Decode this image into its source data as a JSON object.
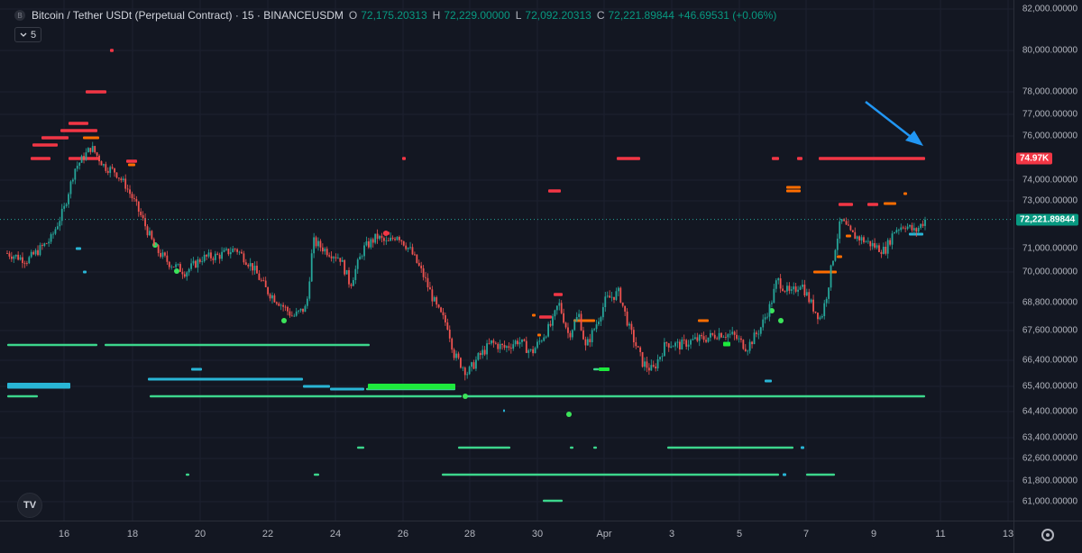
{
  "header": {
    "symbol_icon": "B",
    "title": "Bitcoin / Tether USDt (Perpetual Contract) · 15 · BINANCEUSDM",
    "open_label": "O",
    "open": "72,175.20313",
    "high_label": "H",
    "high": "72,229.00000",
    "low_label": "L",
    "low": "72,092.20313",
    "close_label": "C",
    "close": "72,221.89844",
    "change": "+46.69531 (+0.06%)",
    "indicator_toggle_icon": "chevron-down-icon",
    "indicator_count": "5"
  },
  "price_axis": {
    "labels": [
      "82,000.00000",
      "80,000.00000",
      "78,000.00000",
      "77,000.00000",
      "76,000.00000",
      "74,000.00000",
      "73,000.00000",
      "71,000.00000",
      "70,000.00000",
      "68,800.00000",
      "67,600.00000",
      "66,400.00000",
      "65,400.00000",
      "64,400.00000",
      "63,400.00000",
      "62,600.00000",
      "61,800.00000",
      "61,000.00000"
    ],
    "level_tag": "74.97K",
    "current_tag": "72,221.89844",
    "settings_icon": "gear-icon"
  },
  "time_axis": {
    "labels": [
      "16",
      "18",
      "20",
      "22",
      "24",
      "26",
      "28",
      "30",
      "Apr",
      "3",
      "5",
      "7",
      "9",
      "11",
      "13"
    ]
  },
  "colors": {
    "background": "#131722",
    "up": "#26a69a",
    "down": "#ef5350",
    "resistance": "#f23645",
    "orange": "#ff6d00",
    "support": "#3cd68c",
    "cyan": "#29b6d6",
    "arrow": "#2196f3"
  },
  "logo": "TV",
  "chart_data": {
    "type": "candlestick",
    "symbol": "BTCUSDT.P",
    "interval": "15",
    "x_ticks": [
      "16",
      "18",
      "20",
      "22",
      "24",
      "26",
      "28",
      "30",
      "Apr",
      "3",
      "5",
      "7",
      "9",
      "11",
      "13"
    ],
    "y_ticks": [
      82000,
      80000,
      78000,
      77000,
      76000,
      74000,
      73000,
      71000,
      70000,
      68800,
      67600,
      66400,
      65400,
      64400,
      63400,
      62600,
      61800,
      61000
    ],
    "ylim": [
      60700,
      82200
    ],
    "price_path": [
      [
        0,
        70800
      ],
      [
        0.6,
        70500
      ],
      [
        1.3,
        71400
      ],
      [
        1.7,
        72700
      ],
      [
        2.0,
        74500
      ],
      [
        2.5,
        75500
      ],
      [
        2.9,
        74600
      ],
      [
        3.2,
        74400
      ],
      [
        3.5,
        73800
      ],
      [
        4.0,
        72300
      ],
      [
        4.4,
        71000
      ],
      [
        4.8,
        70400
      ],
      [
        5.3,
        70000
      ],
      [
        5.8,
        70600
      ],
      [
        6.3,
        70700
      ],
      [
        6.8,
        71000
      ],
      [
        7.3,
        70200
      ],
      [
        7.7,
        69300
      ],
      [
        8.1,
        68800
      ],
      [
        8.5,
        68200
      ],
      [
        8.9,
        68600
      ],
      [
        9.1,
        71300
      ],
      [
        9.5,
        70900
      ],
      [
        9.9,
        70600
      ],
      [
        10.2,
        69500
      ],
      [
        10.6,
        71000
      ],
      [
        11.0,
        71500
      ],
      [
        11.3,
        71200
      ],
      [
        11.6,
        71600
      ],
      [
        12.0,
        70900
      ],
      [
        12.4,
        69800
      ],
      [
        12.8,
        68500
      ],
      [
        13.1,
        67800
      ],
      [
        13.3,
        66600
      ],
      [
        13.7,
        65900
      ],
      [
        14.0,
        66500
      ],
      [
        14.4,
        67100
      ],
      [
        14.8,
        66900
      ],
      [
        15.2,
        67200
      ],
      [
        15.6,
        66700
      ],
      [
        15.9,
        67300
      ],
      [
        16.2,
        67900
      ],
      [
        16.4,
        68800
      ],
      [
        16.7,
        67400
      ],
      [
        17.0,
        68300
      ],
      [
        17.2,
        66900
      ],
      [
        17.5,
        67800
      ],
      [
        17.8,
        68900
      ],
      [
        18.2,
        69200
      ],
      [
        18.5,
        67700
      ],
      [
        18.9,
        66300
      ],
      [
        19.2,
        66000
      ],
      [
        19.6,
        67100
      ],
      [
        20.0,
        67000
      ],
      [
        20.4,
        67200
      ],
      [
        20.8,
        67300
      ],
      [
        21.2,
        67500
      ],
      [
        21.6,
        67400
      ],
      [
        22.0,
        66900
      ],
      [
        22.4,
        67700
      ],
      [
        22.7,
        68700
      ],
      [
        22.9,
        69700
      ],
      [
        23.3,
        69100
      ],
      [
        23.6,
        69600
      ],
      [
        24.0,
        68500
      ],
      [
        24.2,
        68100
      ],
      [
        24.4,
        69300
      ],
      [
        24.6,
        70900
      ],
      [
        24.8,
        72200
      ],
      [
        25.1,
        71600
      ],
      [
        25.4,
        71400
      ],
      [
        25.8,
        71100
      ],
      [
        26.1,
        70900
      ],
      [
        26.4,
        71800
      ],
      [
        26.7,
        72000
      ],
      [
        27.0,
        71700
      ],
      [
        27.3,
        72200
      ]
    ],
    "levels": [
      {
        "type": "resistance",
        "price": 74970,
        "label": "74.97K"
      },
      {
        "type": "current",
        "price": 72221.89844
      }
    ]
  }
}
